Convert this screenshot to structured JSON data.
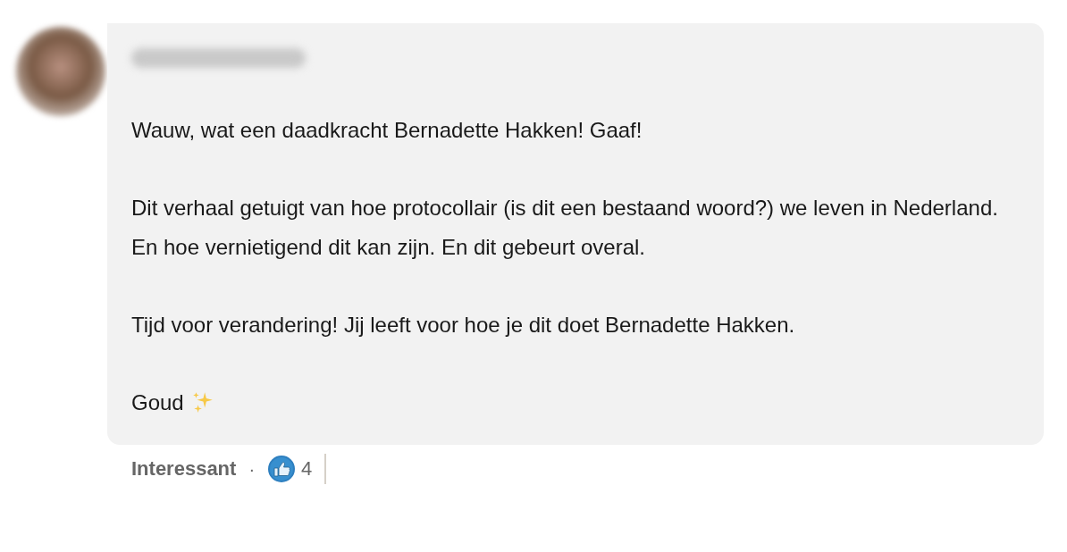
{
  "comment": {
    "paragraphs": [
      {
        "kind": "text",
        "text": "Wauw, wat een daadkracht Bernadette Hakken! Gaaf!"
      },
      {
        "kind": "text",
        "text": "Dit verhaal getuigt van hoe protocollair (is dit een bestaand woord?) we leven in Nederland. En hoe vernietigend dit kan zijn. En dit gebeurt overal."
      },
      {
        "kind": "text",
        "text": "Tijd voor verandering! Jij leeft voor hoe je dit doet Bernadette Hakken."
      },
      {
        "kind": "sparkle",
        "text": "Goud"
      }
    ]
  },
  "footer": {
    "reaction_label": "Interessant",
    "separator": "·",
    "reaction_count": "4"
  }
}
